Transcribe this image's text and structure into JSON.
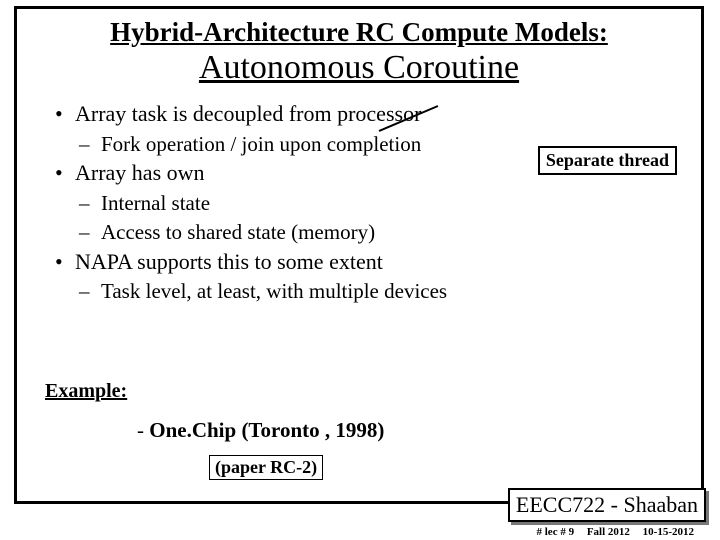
{
  "title_line1": "Hybrid-Architecture RC Compute Models:",
  "title_line2": "Autonomous Coroutine",
  "callout": "Separate thread",
  "bullets": {
    "b1": "Array task is decoupled from processor",
    "b1a": "Fork operation / join upon completion",
    "b2": "Array has own",
    "b2a": "Internal state",
    "b2b": "Access to shared state (memory)",
    "b3": "NAPA supports this to some extent",
    "b3a": "Task level, at least, with multiple devices"
  },
  "example_label": "Example:",
  "example_item": "One.Chip (Toronto , 1998)",
  "paper_ref": "(paper RC-2)",
  "course": "EECC722 - Shaaban",
  "footer": {
    "lec": "#  lec # 9",
    "term": "Fall 2012",
    "date": "10-15-2012"
  }
}
